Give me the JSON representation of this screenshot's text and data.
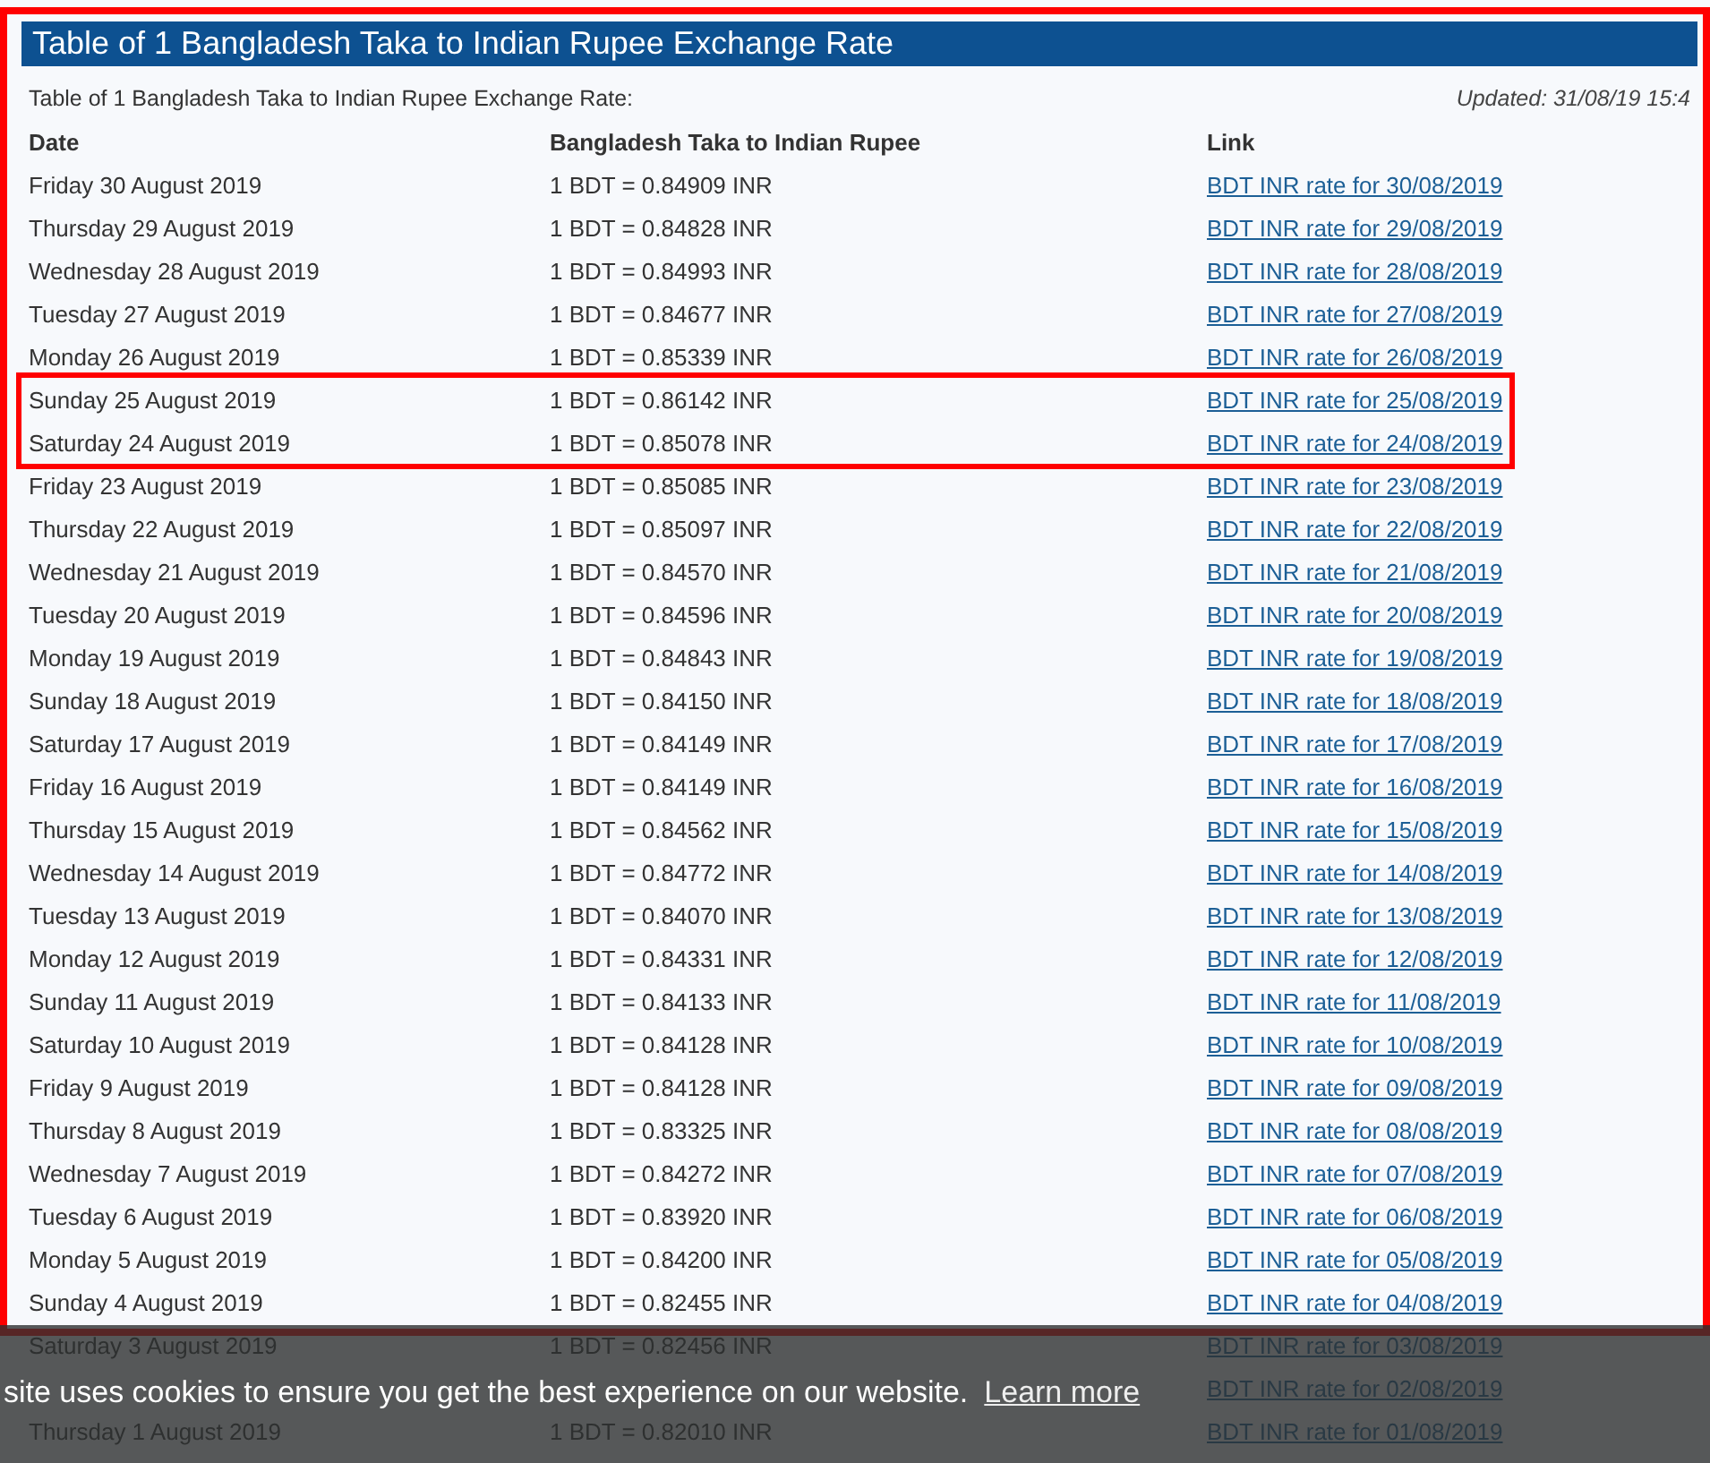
{
  "title": "Table of 1 Bangladesh Taka to Indian Rupee Exchange Rate",
  "caption": "Table of 1 Bangladesh Taka to Indian Rupee Exchange Rate:",
  "updated": "Updated: 31/08/19 15:4",
  "columns": [
    "Date",
    "Bangladesh Taka to Indian Rupee",
    "Link"
  ],
  "rows": [
    {
      "date": "Friday 30 August 2019",
      "rate": "1 BDT = 0.84909 INR",
      "link": "BDT INR rate for 30/08/2019",
      "highlighted": false
    },
    {
      "date": "Thursday 29 August 2019",
      "rate": "1 BDT = 0.84828 INR",
      "link": "BDT INR rate for 29/08/2019",
      "highlighted": false
    },
    {
      "date": "Wednesday 28 August 2019",
      "rate": "1 BDT = 0.84993 INR",
      "link": "BDT INR rate for 28/08/2019",
      "highlighted": false
    },
    {
      "date": "Tuesday 27 August 2019",
      "rate": "1 BDT = 0.84677 INR",
      "link": "BDT INR rate for 27/08/2019",
      "highlighted": false
    },
    {
      "date": "Monday 26 August 2019",
      "rate": "1 BDT = 0.85339 INR",
      "link": "BDT INR rate for 26/08/2019",
      "highlighted": false
    },
    {
      "date": "Sunday 25 August 2019",
      "rate": "1 BDT = 0.86142 INR",
      "link": "BDT INR rate for 25/08/2019",
      "highlighted": true
    },
    {
      "date": "Saturday 24 August 2019",
      "rate": "1 BDT = 0.85078 INR",
      "link": "BDT INR rate for 24/08/2019",
      "highlighted": true
    },
    {
      "date": "Friday 23 August 2019",
      "rate": "1 BDT = 0.85085 INR",
      "link": "BDT INR rate for 23/08/2019",
      "highlighted": false
    },
    {
      "date": "Thursday 22 August 2019",
      "rate": "1 BDT = 0.85097 INR",
      "link": "BDT INR rate for 22/08/2019",
      "highlighted": false
    },
    {
      "date": "Wednesday 21 August 2019",
      "rate": "1 BDT = 0.84570 INR",
      "link": "BDT INR rate for 21/08/2019",
      "highlighted": false
    },
    {
      "date": "Tuesday 20 August 2019",
      "rate": "1 BDT = 0.84596 INR",
      "link": "BDT INR rate for 20/08/2019",
      "highlighted": false
    },
    {
      "date": "Monday 19 August 2019",
      "rate": "1 BDT = 0.84843 INR",
      "link": "BDT INR rate for 19/08/2019",
      "highlighted": false
    },
    {
      "date": "Sunday 18 August 2019",
      "rate": "1 BDT = 0.84150 INR",
      "link": "BDT INR rate for 18/08/2019",
      "highlighted": false
    },
    {
      "date": "Saturday 17 August 2019",
      "rate": "1 BDT = 0.84149 INR",
      "link": "BDT INR rate for 17/08/2019",
      "highlighted": false
    },
    {
      "date": "Friday 16 August 2019",
      "rate": "1 BDT = 0.84149 INR",
      "link": "BDT INR rate for 16/08/2019",
      "highlighted": false
    },
    {
      "date": "Thursday 15 August 2019",
      "rate": "1 BDT = 0.84562 INR",
      "link": "BDT INR rate for 15/08/2019",
      "highlighted": false
    },
    {
      "date": "Wednesday 14 August 2019",
      "rate": "1 BDT = 0.84772 INR",
      "link": "BDT INR rate for 14/08/2019",
      "highlighted": false
    },
    {
      "date": "Tuesday 13 August 2019",
      "rate": "1 BDT = 0.84070 INR",
      "link": "BDT INR rate for 13/08/2019",
      "highlighted": false
    },
    {
      "date": "Monday 12 August 2019",
      "rate": "1 BDT = 0.84331 INR",
      "link": "BDT INR rate for 12/08/2019",
      "highlighted": false
    },
    {
      "date": "Sunday 11 August 2019",
      "rate": "1 BDT = 0.84133 INR",
      "link": "BDT INR rate for 11/08/2019",
      "highlighted": false
    },
    {
      "date": "Saturday 10 August 2019",
      "rate": "1 BDT = 0.84128 INR",
      "link": "BDT INR rate for 10/08/2019",
      "highlighted": false
    },
    {
      "date": "Friday 9 August 2019",
      "rate": "1 BDT = 0.84128 INR",
      "link": "BDT INR rate for 09/08/2019",
      "highlighted": false
    },
    {
      "date": "Thursday 8 August 2019",
      "rate": "1 BDT = 0.83325 INR",
      "link": "BDT INR rate for 08/08/2019",
      "highlighted": false
    },
    {
      "date": "Wednesday 7 August 2019",
      "rate": "1 BDT = 0.84272 INR",
      "link": "BDT INR rate for 07/08/2019",
      "highlighted": false
    },
    {
      "date": "Tuesday 6 August 2019",
      "rate": "1 BDT = 0.83920 INR",
      "link": "BDT INR rate for 06/08/2019",
      "highlighted": false
    },
    {
      "date": "Monday 5 August 2019",
      "rate": "1 BDT = 0.84200 INR",
      "link": "BDT INR rate for 05/08/2019",
      "highlighted": false
    },
    {
      "date": "Sunday 4 August 2019",
      "rate": "1 BDT = 0.82455 INR",
      "link": "BDT INR rate for 04/08/2019",
      "highlighted": false
    },
    {
      "date": "Saturday 3 August 2019",
      "rate": "1 BDT = 0.82456 INR",
      "link": "BDT INR rate for 03/08/2019",
      "highlighted": false
    },
    {
      "link": "BDT INR rate for 02/08/2019",
      "highlighted": false
    },
    {
      "date": "Thursday 1 August 2019",
      "rate": "1 BDT = 0.82010 INR",
      "link": "BDT INR rate for 01/08/2019",
      "highlighted": false
    }
  ],
  "outline_frame": true,
  "cookie_banner": {
    "text": "site uses cookies to ensure you get the best experience on our website.",
    "link": "Learn more"
  }
}
